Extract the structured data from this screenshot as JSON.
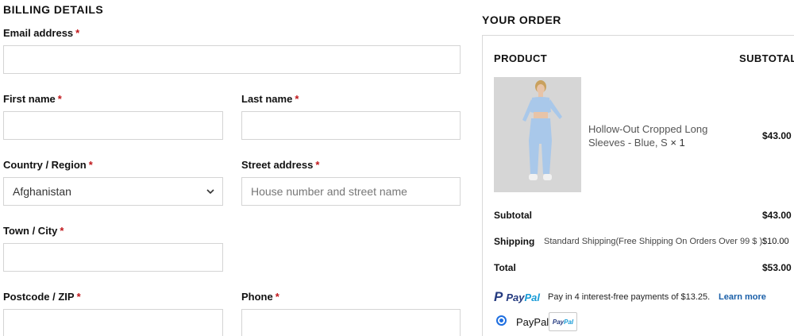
{
  "billing": {
    "title": "BILLING DETAILS",
    "required_mark": "*",
    "email": {
      "label": "Email address",
      "value": ""
    },
    "first_name": {
      "label": "First name",
      "value": ""
    },
    "last_name": {
      "label": "Last name",
      "value": ""
    },
    "country": {
      "label": "Country / Region",
      "value": "Afghanistan"
    },
    "street": {
      "label": "Street address",
      "placeholder": "House number and street name",
      "value": ""
    },
    "city": {
      "label": "Town / City",
      "value": ""
    },
    "postcode": {
      "label": "Postcode / ZIP",
      "value": ""
    },
    "phone": {
      "label": "Phone",
      "value": ""
    }
  },
  "order": {
    "title": "YOUR ORDER",
    "col_product": "PRODUCT",
    "col_subtotal": "SUBTOTAL",
    "item": {
      "name_line1": "Hollow-Out Cropped Long",
      "name_line2": "Sleeves - Blue, S",
      "qty": "× 1",
      "price": "$43.00"
    },
    "subtotal_label": "Subtotal",
    "subtotal_value": "$43.00",
    "shipping_label": "Shipping",
    "shipping_desc": "Standard Shipping(Free Shipping On Orders Over 99 $ ):",
    "shipping_value": "$10.00",
    "total_label": "Total",
    "total_value": "$53.00"
  },
  "paypal": {
    "logo_p": "P",
    "logo_pay": "Pay",
    "logo_pal": "Pal",
    "message": "Pay in 4 interest-free payments of $13.25.",
    "learn_more": "Learn more",
    "option_label": "PayPal",
    "badge_pay": "Pay",
    "badge_pal": "Pal"
  },
  "colors": {
    "required": "#c0161a",
    "paypal_dark": "#253b80",
    "paypal_light": "#179bd7",
    "radio": "#1f6fe0",
    "link": "#1a5fa8"
  }
}
